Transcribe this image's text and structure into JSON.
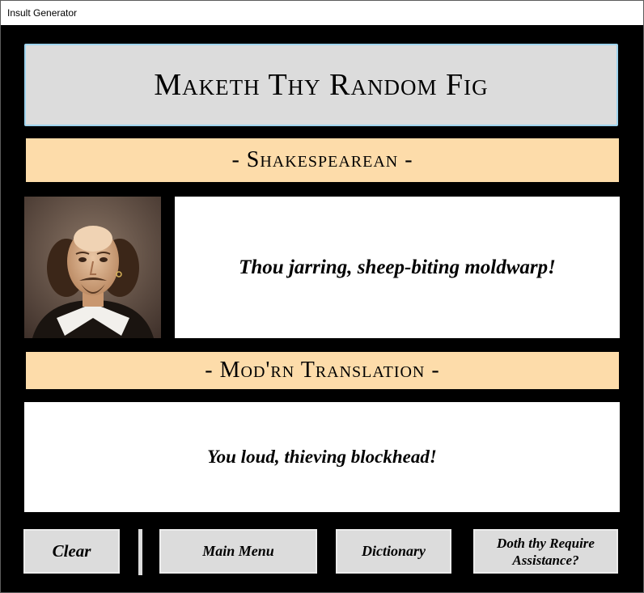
{
  "window": {
    "title": "Insult Generator"
  },
  "header": {
    "title": "Maketh Thy Random Fig"
  },
  "sections": {
    "shakespearean_label": "- Shakespearean -",
    "modern_label": "- Mod'rn Translation -"
  },
  "insult": {
    "shakespearean": "Thou jarring, sheep-biting moldwarp!",
    "modern": "You loud, thieving blockhead!"
  },
  "portrait": {
    "subject": "William Shakespeare"
  },
  "buttons": {
    "clear": "Clear",
    "main_menu": "Main Menu",
    "dictionary": "Dictionary",
    "help_line1": "Doth thy Require",
    "help_line2": "Assistance?"
  },
  "colors": {
    "header_bg": "#dcdcdc",
    "band_bg": "#fddcaa",
    "background": "#000000"
  }
}
